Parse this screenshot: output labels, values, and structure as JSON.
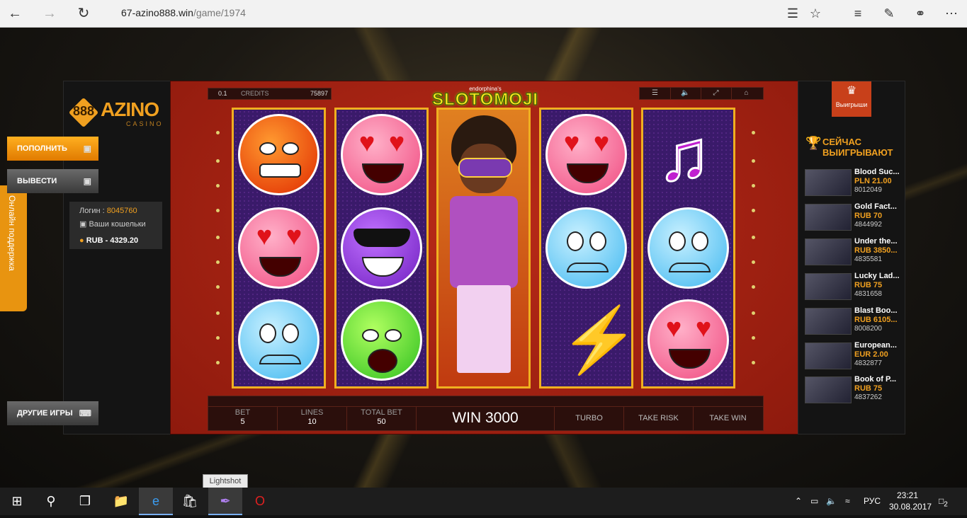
{
  "browser": {
    "url_host": "67-azino888.win",
    "url_path": "/game/1974"
  },
  "left_panel": {
    "logo_badge": "888",
    "logo_name": "AZINO",
    "logo_sub": "CASINO",
    "deposit_label": "ПОПОЛНИТЬ",
    "withdraw_label": "ВЫВЕСТИ",
    "login_label": "Логин :",
    "login_value": "8045760",
    "wallets_label": "Ваши кошельки",
    "balance": "RUB - 4329.20",
    "other_games_label": "ДРУГИЕ ИГРЫ"
  },
  "support_tab": "Онлайн поддержка",
  "game": {
    "bet_value": "0.1",
    "credits_label": "CREDITS",
    "credits_value": "75897",
    "brand_small": "endorphina's",
    "brand_big": "SLOTOMOJI",
    "controls": {
      "bet_label": "BET",
      "bet": "5",
      "lines_label": "LINES",
      "lines": "10",
      "total_bet_label": "TOTAL BET",
      "total_bet": "50",
      "win": "WIN 3000",
      "turbo": "TURBO",
      "take_risk": "TAKE RISK",
      "take_win": "TAKE WIN"
    }
  },
  "right_panel": {
    "badge_label": "Выигрыши",
    "heading": "СЕЙЧАС ВЫИГРЫВАЮТ",
    "winners": [
      {
        "game": "Blood Suc...",
        "amount": "PLN 21.00",
        "user": "8012049"
      },
      {
        "game": "Gold Fact...",
        "amount": "RUB 70",
        "user": "4844992"
      },
      {
        "game": "Under the...",
        "amount": "RUB 3850...",
        "user": "4835581"
      },
      {
        "game": "Lucky Lad...",
        "amount": "RUB 75",
        "user": "4831658"
      },
      {
        "game": "Blast Boo...",
        "amount": "RUB 6105...",
        "user": "8008200"
      },
      {
        "game": "European...",
        "amount": "EUR 2.00",
        "user": "4832877"
      },
      {
        "game": "Book of P...",
        "amount": "RUB 75",
        "user": "4837262"
      }
    ]
  },
  "tooltip": "Lightshot",
  "taskbar": {
    "lang": "РУС",
    "time": "23:21",
    "date": "30.08.2017",
    "notif_count": "2"
  },
  "colors": {
    "accent": "#f0a020",
    "game_bg": "#a82012",
    "reel_border": "#f0b020"
  }
}
